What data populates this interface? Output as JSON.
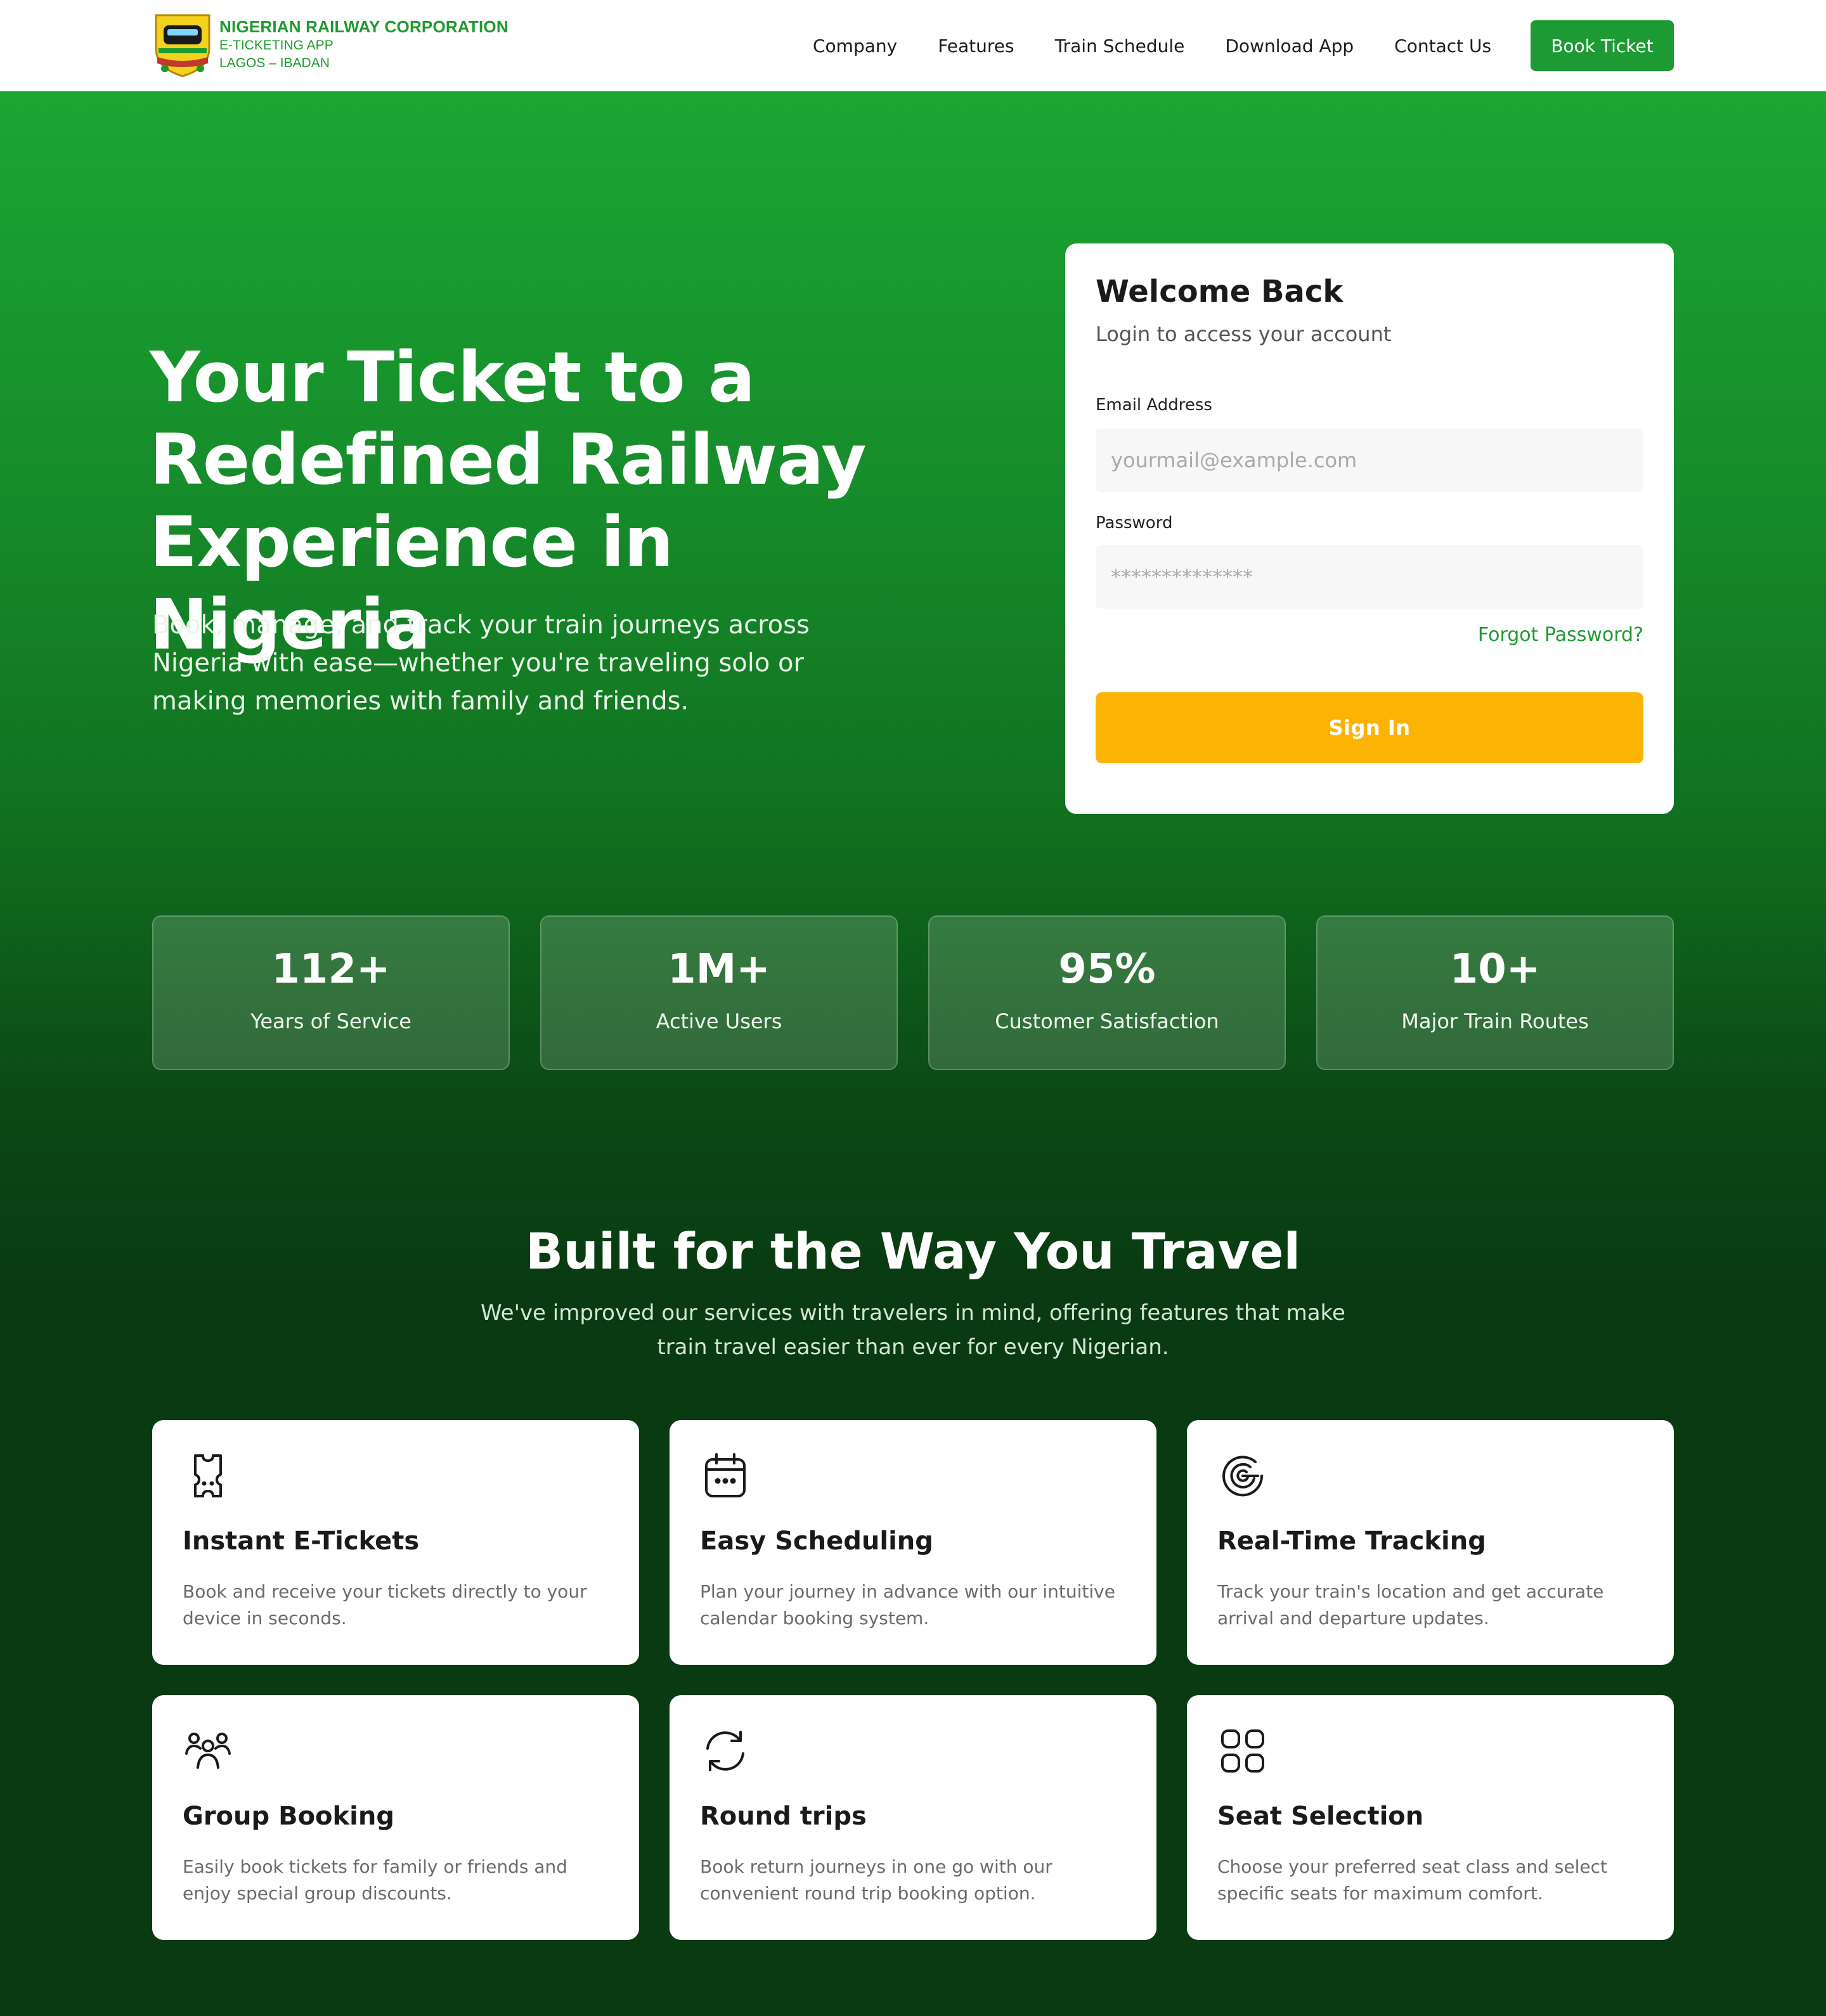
{
  "brand": {
    "name": "NIGERIAN RAILWAY CORPORATION",
    "tagline": "E-TICKETING APP",
    "route": "LAGOS – IBADAN",
    "color": "#1e9a2e"
  },
  "nav": {
    "items": [
      "Company",
      "Features",
      "Train Schedule",
      "Download App",
      "Contact Us"
    ],
    "cta": "Book Ticket"
  },
  "hero": {
    "title": "Your Ticket to a Redefined Railway Experience in Nigeria",
    "subtitle": "Book, manage, and track your train journeys across Nigeria with ease—whether you're traveling solo or making memories with family and friends."
  },
  "login": {
    "title": "Welcome Back",
    "subtitle": "Login to access your account",
    "email_label": "Email Address",
    "email_placeholder": "yourmail@example.com",
    "password_label": "Password",
    "password_placeholder": "**************",
    "forgot": "Forgot Password?",
    "submit": "Sign In",
    "submit_color": "#fbb404"
  },
  "stats": [
    {
      "value": "112+",
      "label": "Years of Service"
    },
    {
      "value": "1M+",
      "label": "Active Users"
    },
    {
      "value": "95%",
      "label": "Customer Satisfaction"
    },
    {
      "value": "10+",
      "label": "Major Train Routes"
    }
  ],
  "features": {
    "title": "Built for the Way You Travel",
    "subtitle": "We've improved our services with travelers in mind, offering features that make train travel easier than ever for every Nigerian.",
    "items": [
      {
        "icon": "ticket-icon",
        "title": "Instant E-Tickets",
        "desc": "Book and receive your tickets directly to your device in seconds."
      },
      {
        "icon": "calendar-icon",
        "title": "Easy Scheduling",
        "desc": "Plan your journey in advance with our intuitive calendar booking system."
      },
      {
        "icon": "tracking-icon",
        "title": "Real-Time Tracking",
        "desc": "Track your train's location and get accurate arrival and departure updates."
      },
      {
        "icon": "group-icon",
        "title": "Group Booking",
        "desc": "Easily book tickets for family or friends and enjoy special group discounts."
      },
      {
        "icon": "round-trip-icon",
        "title": "Round trips",
        "desc": "Book return journeys in one go with our convenient round trip booking option."
      },
      {
        "icon": "seat-grid-icon",
        "title": "Seat Selection",
        "desc": "Choose your preferred seat class and select specific seats for maximum comfort."
      }
    ]
  }
}
